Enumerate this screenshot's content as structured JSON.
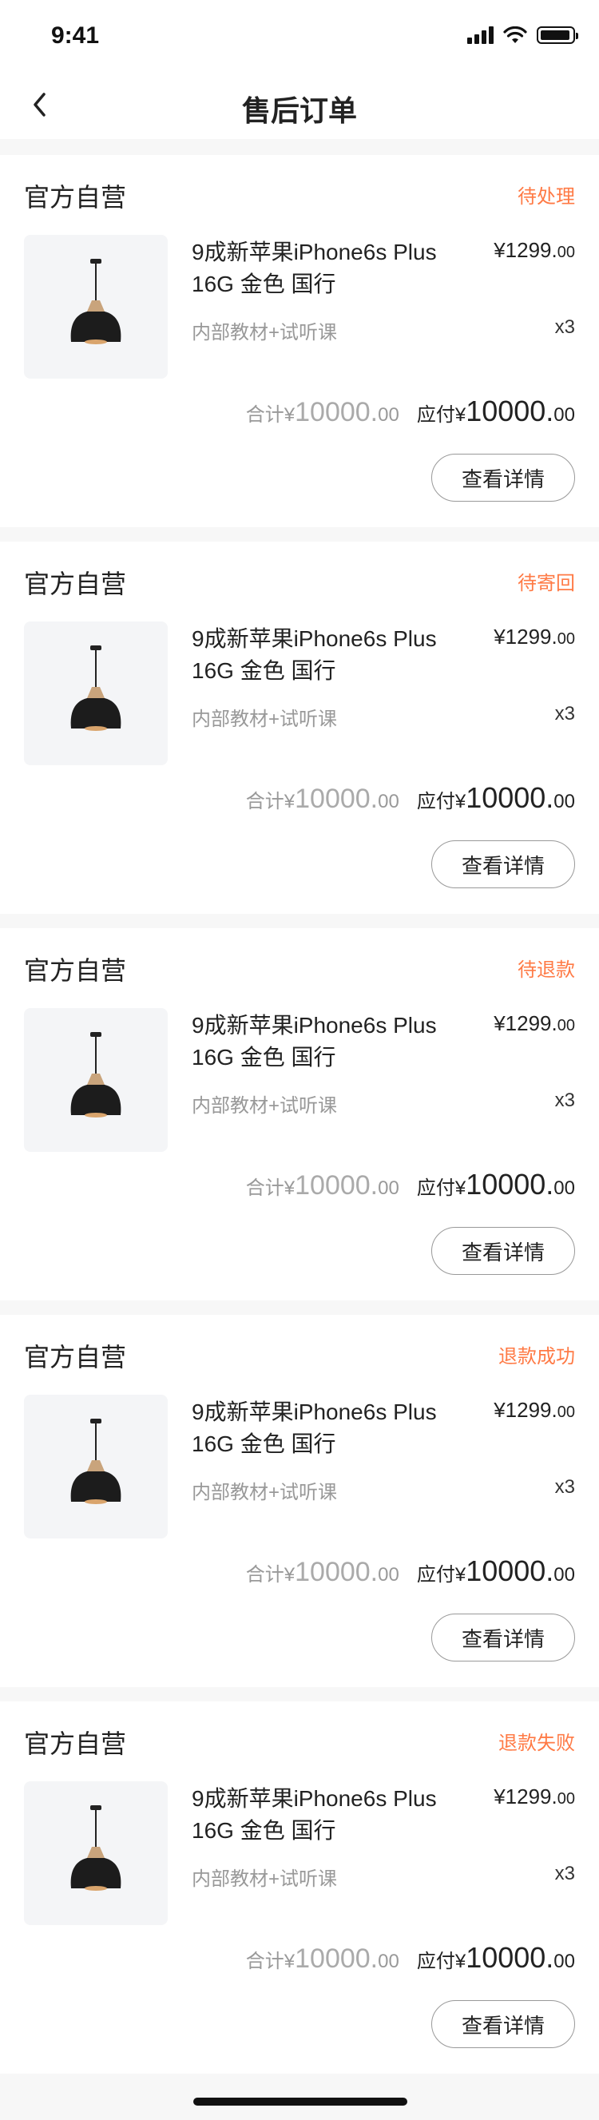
{
  "status_bar": {
    "time": "9:41"
  },
  "header": {
    "title": "售后订单"
  },
  "colors": {
    "accent": "#ff7a45"
  },
  "orders": [
    {
      "shop": "官方自营",
      "status": "待处理",
      "product_line1": "9成新苹果iPhone6s Plus",
      "product_line2": "16G 金色 国行",
      "price_int": "¥1299.",
      "price_dec": "00",
      "desc": "内部教材+试听课",
      "qty": "x3",
      "total_label": "合计",
      "total_cur": "¥",
      "total_int": "10000.",
      "total_dec": "00",
      "pay_label": "应付",
      "pay_cur": "¥",
      "pay_int": "10000.",
      "pay_dec": "00",
      "button": "查看详情"
    },
    {
      "shop": "官方自营",
      "status": "待寄回",
      "product_line1": "9成新苹果iPhone6s Plus",
      "product_line2": "16G 金色 国行",
      "price_int": "¥1299.",
      "price_dec": "00",
      "desc": "内部教材+试听课",
      "qty": "x3",
      "total_label": "合计",
      "total_cur": "¥",
      "total_int": "10000.",
      "total_dec": "00",
      "pay_label": "应付",
      "pay_cur": "¥",
      "pay_int": "10000.",
      "pay_dec": "00",
      "button": "查看详情"
    },
    {
      "shop": "官方自营",
      "status": "待退款",
      "product_line1": "9成新苹果iPhone6s Plus",
      "product_line2": "16G 金色 国行",
      "price_int": "¥1299.",
      "price_dec": "00",
      "desc": "内部教材+试听课",
      "qty": "x3",
      "total_label": "合计",
      "total_cur": "¥",
      "total_int": "10000.",
      "total_dec": "00",
      "pay_label": "应付",
      "pay_cur": "¥",
      "pay_int": "10000.",
      "pay_dec": "00",
      "button": "查看详情"
    },
    {
      "shop": "官方自营",
      "status": "退款成功",
      "product_line1": "9成新苹果iPhone6s Plus",
      "product_line2": "16G 金色 国行",
      "price_int": "¥1299.",
      "price_dec": "00",
      "desc": "内部教材+试听课",
      "qty": "x3",
      "total_label": "合计",
      "total_cur": "¥",
      "total_int": "10000.",
      "total_dec": "00",
      "pay_label": "应付",
      "pay_cur": "¥",
      "pay_int": "10000.",
      "pay_dec": "00",
      "button": "查看详情"
    },
    {
      "shop": "官方自营",
      "status": "退款失败",
      "product_line1": "9成新苹果iPhone6s Plus",
      "product_line2": "16G 金色 国行",
      "price_int": "¥1299.",
      "price_dec": "00",
      "desc": "内部教材+试听课",
      "qty": "x3",
      "total_label": "合计",
      "total_cur": "¥",
      "total_int": "10000.",
      "total_dec": "00",
      "pay_label": "应付",
      "pay_cur": "¥",
      "pay_int": "10000.",
      "pay_dec": "00",
      "button": "查看详情"
    }
  ]
}
